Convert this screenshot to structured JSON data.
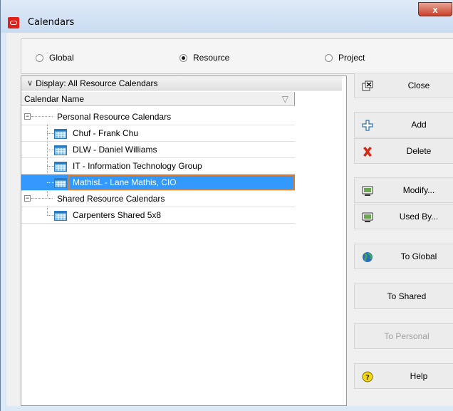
{
  "window": {
    "title": "Calendars",
    "close_glyph": "x"
  },
  "radios": [
    {
      "label": "Global",
      "selected": false
    },
    {
      "label": "Resource",
      "selected": true
    },
    {
      "label": "Project",
      "selected": false
    }
  ],
  "tree": {
    "display_label": "Display: All Resource Calendars",
    "column_header": "Calendar Name",
    "rows": [
      {
        "label": "Personal Resource Calendars",
        "type": "group"
      },
      {
        "label": "Chuf - Frank Chu",
        "type": "calendar"
      },
      {
        "label": "DLW - Daniel Williams",
        "type": "calendar"
      },
      {
        "label": "IT - Information Technology Group",
        "type": "calendar"
      },
      {
        "label": "MathisL - Lane Mathis, CIO",
        "type": "calendar",
        "selected": true
      },
      {
        "label": "Shared Resource Calendars",
        "type": "group"
      },
      {
        "label": "Carpenters Shared 5x8",
        "type": "calendar"
      }
    ]
  },
  "buttons": [
    {
      "label": "Close",
      "icon": "close-window-icon"
    },
    {
      "label": "Add",
      "icon": "plus-icon"
    },
    {
      "label": "Delete",
      "icon": "red-x-icon"
    },
    {
      "label": "Modify...",
      "icon": "monitor-edit-icon"
    },
    {
      "label": "Used By...",
      "icon": "monitor-edit-icon"
    },
    {
      "label": "To Global",
      "icon": "globe-icon"
    },
    {
      "label": "To Shared",
      "icon": ""
    },
    {
      "label": "To Personal",
      "icon": "",
      "disabled": true
    },
    {
      "label": "Help",
      "icon": "help-icon"
    }
  ],
  "colors": {
    "selection": "#3399ff",
    "focus_border": "#e07b2a",
    "title_close": "#c8412b"
  }
}
